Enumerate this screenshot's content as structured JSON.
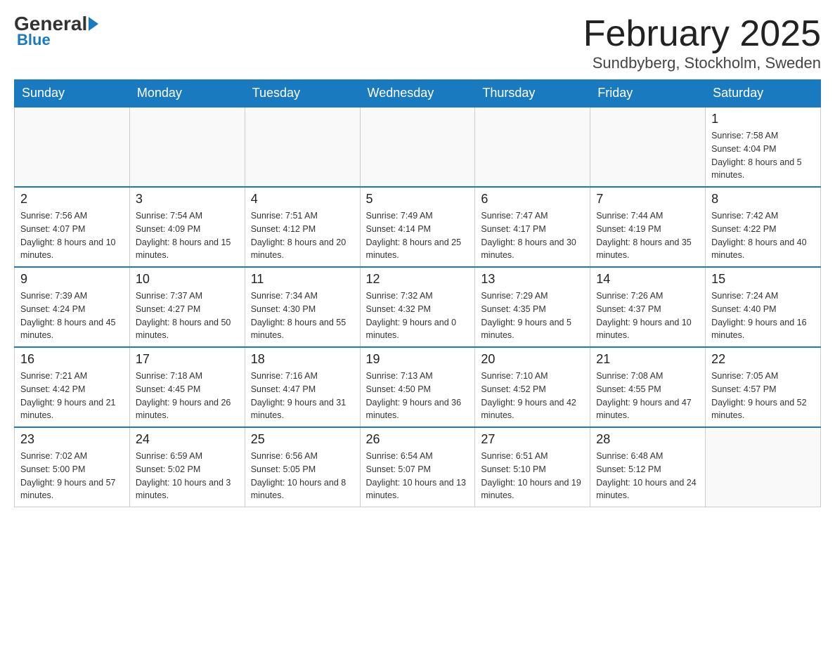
{
  "header": {
    "logo": {
      "part1": "General",
      "part2": "Blue"
    },
    "title": "February 2025",
    "location": "Sundbyberg, Stockholm, Sweden"
  },
  "days_of_week": [
    "Sunday",
    "Monday",
    "Tuesday",
    "Wednesday",
    "Thursday",
    "Friday",
    "Saturday"
  ],
  "weeks": [
    [
      {
        "day": "",
        "info": ""
      },
      {
        "day": "",
        "info": ""
      },
      {
        "day": "",
        "info": ""
      },
      {
        "day": "",
        "info": ""
      },
      {
        "day": "",
        "info": ""
      },
      {
        "day": "",
        "info": ""
      },
      {
        "day": "1",
        "info": "Sunrise: 7:58 AM\nSunset: 4:04 PM\nDaylight: 8 hours and 5 minutes."
      }
    ],
    [
      {
        "day": "2",
        "info": "Sunrise: 7:56 AM\nSunset: 4:07 PM\nDaylight: 8 hours and 10 minutes."
      },
      {
        "day": "3",
        "info": "Sunrise: 7:54 AM\nSunset: 4:09 PM\nDaylight: 8 hours and 15 minutes."
      },
      {
        "day": "4",
        "info": "Sunrise: 7:51 AM\nSunset: 4:12 PM\nDaylight: 8 hours and 20 minutes."
      },
      {
        "day": "5",
        "info": "Sunrise: 7:49 AM\nSunset: 4:14 PM\nDaylight: 8 hours and 25 minutes."
      },
      {
        "day": "6",
        "info": "Sunrise: 7:47 AM\nSunset: 4:17 PM\nDaylight: 8 hours and 30 minutes."
      },
      {
        "day": "7",
        "info": "Sunrise: 7:44 AM\nSunset: 4:19 PM\nDaylight: 8 hours and 35 minutes."
      },
      {
        "day": "8",
        "info": "Sunrise: 7:42 AM\nSunset: 4:22 PM\nDaylight: 8 hours and 40 minutes."
      }
    ],
    [
      {
        "day": "9",
        "info": "Sunrise: 7:39 AM\nSunset: 4:24 PM\nDaylight: 8 hours and 45 minutes."
      },
      {
        "day": "10",
        "info": "Sunrise: 7:37 AM\nSunset: 4:27 PM\nDaylight: 8 hours and 50 minutes."
      },
      {
        "day": "11",
        "info": "Sunrise: 7:34 AM\nSunset: 4:30 PM\nDaylight: 8 hours and 55 minutes."
      },
      {
        "day": "12",
        "info": "Sunrise: 7:32 AM\nSunset: 4:32 PM\nDaylight: 9 hours and 0 minutes."
      },
      {
        "day": "13",
        "info": "Sunrise: 7:29 AM\nSunset: 4:35 PM\nDaylight: 9 hours and 5 minutes."
      },
      {
        "day": "14",
        "info": "Sunrise: 7:26 AM\nSunset: 4:37 PM\nDaylight: 9 hours and 10 minutes."
      },
      {
        "day": "15",
        "info": "Sunrise: 7:24 AM\nSunset: 4:40 PM\nDaylight: 9 hours and 16 minutes."
      }
    ],
    [
      {
        "day": "16",
        "info": "Sunrise: 7:21 AM\nSunset: 4:42 PM\nDaylight: 9 hours and 21 minutes."
      },
      {
        "day": "17",
        "info": "Sunrise: 7:18 AM\nSunset: 4:45 PM\nDaylight: 9 hours and 26 minutes."
      },
      {
        "day": "18",
        "info": "Sunrise: 7:16 AM\nSunset: 4:47 PM\nDaylight: 9 hours and 31 minutes."
      },
      {
        "day": "19",
        "info": "Sunrise: 7:13 AM\nSunset: 4:50 PM\nDaylight: 9 hours and 36 minutes."
      },
      {
        "day": "20",
        "info": "Sunrise: 7:10 AM\nSunset: 4:52 PM\nDaylight: 9 hours and 42 minutes."
      },
      {
        "day": "21",
        "info": "Sunrise: 7:08 AM\nSunset: 4:55 PM\nDaylight: 9 hours and 47 minutes."
      },
      {
        "day": "22",
        "info": "Sunrise: 7:05 AM\nSunset: 4:57 PM\nDaylight: 9 hours and 52 minutes."
      }
    ],
    [
      {
        "day": "23",
        "info": "Sunrise: 7:02 AM\nSunset: 5:00 PM\nDaylight: 9 hours and 57 minutes."
      },
      {
        "day": "24",
        "info": "Sunrise: 6:59 AM\nSunset: 5:02 PM\nDaylight: 10 hours and 3 minutes."
      },
      {
        "day": "25",
        "info": "Sunrise: 6:56 AM\nSunset: 5:05 PM\nDaylight: 10 hours and 8 minutes."
      },
      {
        "day": "26",
        "info": "Sunrise: 6:54 AM\nSunset: 5:07 PM\nDaylight: 10 hours and 13 minutes."
      },
      {
        "day": "27",
        "info": "Sunrise: 6:51 AM\nSunset: 5:10 PM\nDaylight: 10 hours and 19 minutes."
      },
      {
        "day": "28",
        "info": "Sunrise: 6:48 AM\nSunset: 5:12 PM\nDaylight: 10 hours and 24 minutes."
      },
      {
        "day": "",
        "info": ""
      }
    ]
  ]
}
